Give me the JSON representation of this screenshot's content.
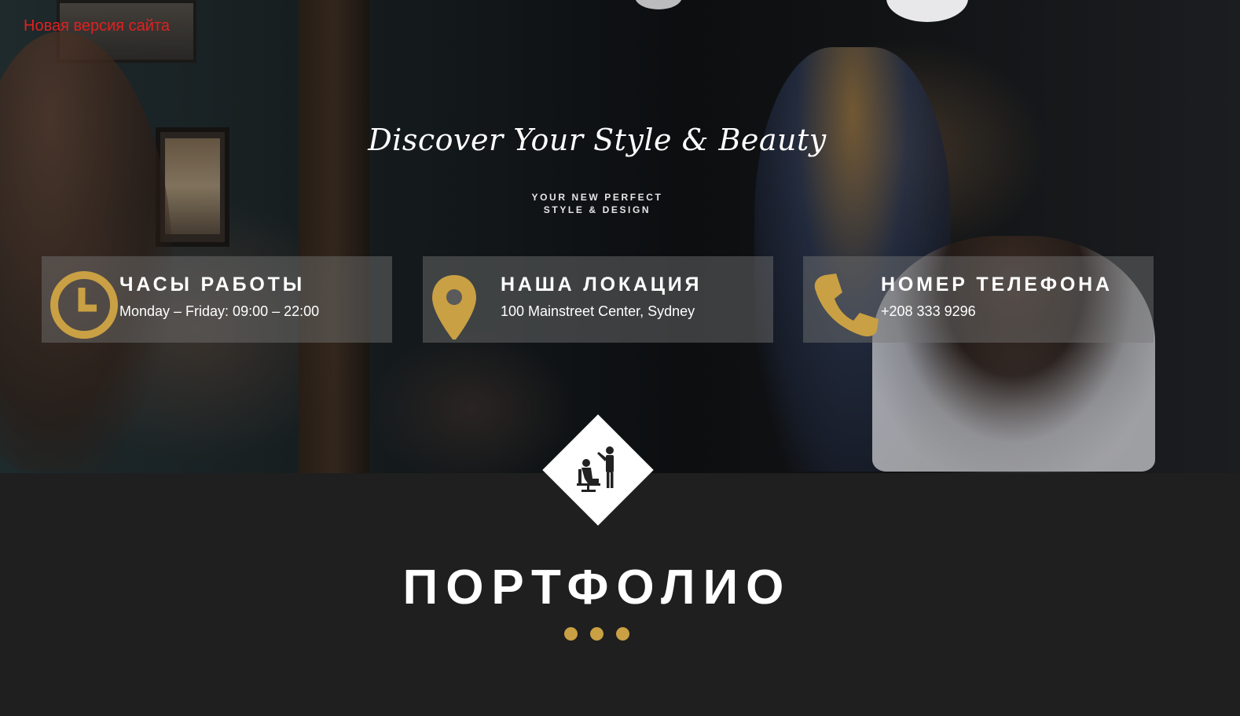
{
  "top_link": {
    "label": "Новая версия сайта"
  },
  "hero": {
    "tagline": "Discover Your Style & Beauty",
    "subtitle_line1": "YOUR NEW PERFECT",
    "subtitle_line2": "STYLE & DESIGN"
  },
  "info": [
    {
      "title": "ЧАСЫ РАБОТЫ",
      "text": "Monday – Friday: 09:00 – 22:00",
      "icon": "clock-icon"
    },
    {
      "title": "НАША ЛОКАЦИЯ",
      "text": "100 Mainstreet Center, Sydney",
      "icon": "map-pin-icon"
    },
    {
      "title": "НОМЕР ТЕЛЕФОНА",
      "text": "+208 333 9296",
      "icon": "phone-icon"
    }
  ],
  "section": {
    "title": "ПОРТФОЛИО",
    "icon": "barber-icon"
  },
  "colors": {
    "accent": "#c9a043",
    "link": "#e02020",
    "background": "#1f1f1f"
  }
}
